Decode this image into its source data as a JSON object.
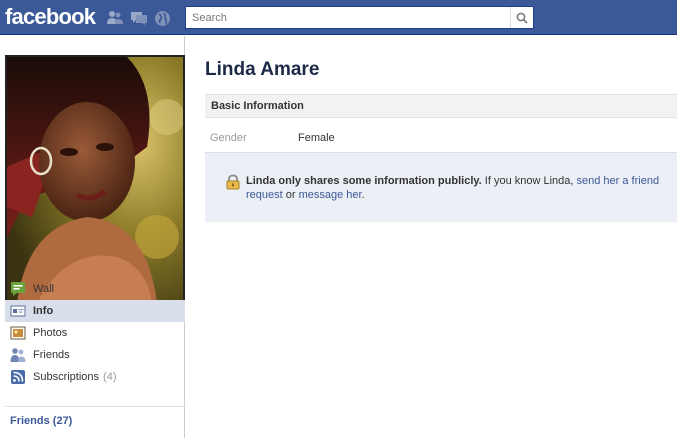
{
  "topbar": {
    "logo": "facebook",
    "search_placeholder": "Search",
    "icons": [
      "friend-requests-icon",
      "messages-icon",
      "notifications-globe-icon",
      "search-magnifier-icon"
    ]
  },
  "profile": {
    "name": "Linda Amare"
  },
  "nav": {
    "items": [
      {
        "label": "Wall",
        "icon": "wall-icon"
      },
      {
        "label": "Info",
        "icon": "info-icon",
        "selected": true
      },
      {
        "label": "Photos",
        "icon": "photos-icon"
      },
      {
        "label": "Friends",
        "icon": "friends-icon"
      },
      {
        "label": "Subscriptions",
        "icon": "subscriptions-icon",
        "count": "(4)"
      }
    ],
    "friends_link": "Friends (27)"
  },
  "info": {
    "section_title": "Basic Information",
    "gender_label": "Gender",
    "gender_value": "Female"
  },
  "notice": {
    "bold": "Linda only shares some information publicly.",
    "text1": " If you know Linda, ",
    "link1": "send her a friend request",
    "text2": " or ",
    "link2": "message her",
    "text3": "."
  },
  "colors": {
    "brand": "#3b5998",
    "nav_selected": "#d8dfea",
    "notice_bg": "#eceff5"
  }
}
